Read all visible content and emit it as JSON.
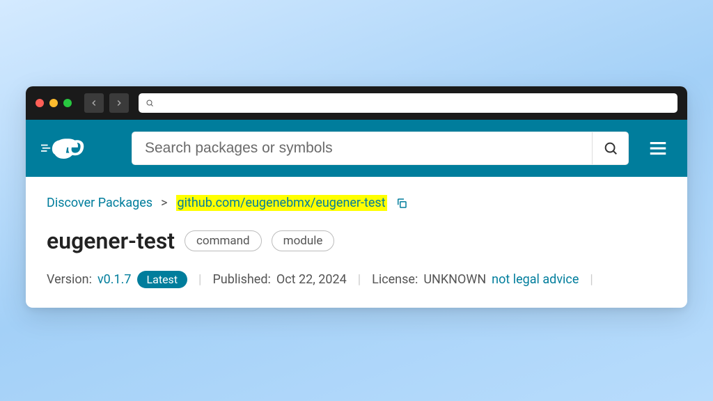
{
  "search": {
    "placeholder": "Search packages or symbols"
  },
  "breadcrumb": {
    "root": "Discover Packages",
    "separator": ">",
    "path": "github.com/eugenebmx/eugener-test"
  },
  "package": {
    "name": "eugener-test",
    "tags": [
      "command",
      "module"
    ]
  },
  "meta": {
    "version_label": "Version:",
    "version": "v0.1.7",
    "latest_badge": "Latest",
    "published_label": "Published:",
    "published_date": "Oct 22, 2024",
    "license_label": "License:",
    "license_value": "UNKNOWN",
    "legal_notice": "not legal advice"
  }
}
